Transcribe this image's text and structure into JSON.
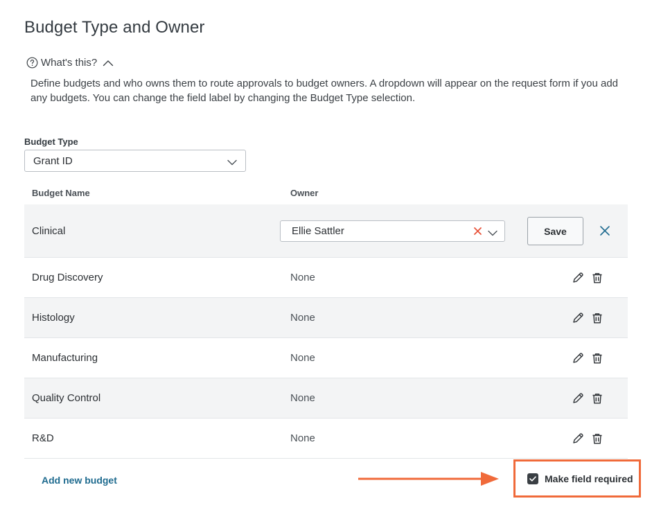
{
  "page": {
    "title": "Budget Type and Owner"
  },
  "help": {
    "toggle_label": "What's this?",
    "description": "Define budgets and who owns them to route approvals to budget owners. A dropdown will appear on the request form if you add any budgets. You can change the field label by changing the Budget Type selection."
  },
  "budget_type": {
    "label": "Budget Type",
    "selected": "Grant ID"
  },
  "table": {
    "headers": {
      "name": "Budget Name",
      "owner": "Owner"
    },
    "editing_row": {
      "name": "Clinical",
      "owner_selected": "Ellie Sattler",
      "save_label": "Save"
    },
    "rows": [
      {
        "name": "Drug Discovery",
        "owner": "None"
      },
      {
        "name": "Histology",
        "owner": "None"
      },
      {
        "name": "Manufacturing",
        "owner": "None"
      },
      {
        "name": "Quality Control",
        "owner": "None"
      },
      {
        "name": "R&D",
        "owner": "None"
      }
    ]
  },
  "footer": {
    "add_label": "Add new budget",
    "required_label": "Make field required",
    "required_checked": true
  },
  "colors": {
    "accent_link": "#1f6b8f",
    "annotation": "#f06a3a",
    "clear_x": "#e8533a"
  },
  "icons": {
    "help": "question-circle-icon",
    "collapse": "chevron-up-icon",
    "dropdown": "chevron-down-icon",
    "clear": "clear-x-icon",
    "cancel": "close-icon",
    "edit": "pencil-icon",
    "delete": "trash-icon",
    "check": "check-icon",
    "arrow": "arrow-right-icon"
  }
}
